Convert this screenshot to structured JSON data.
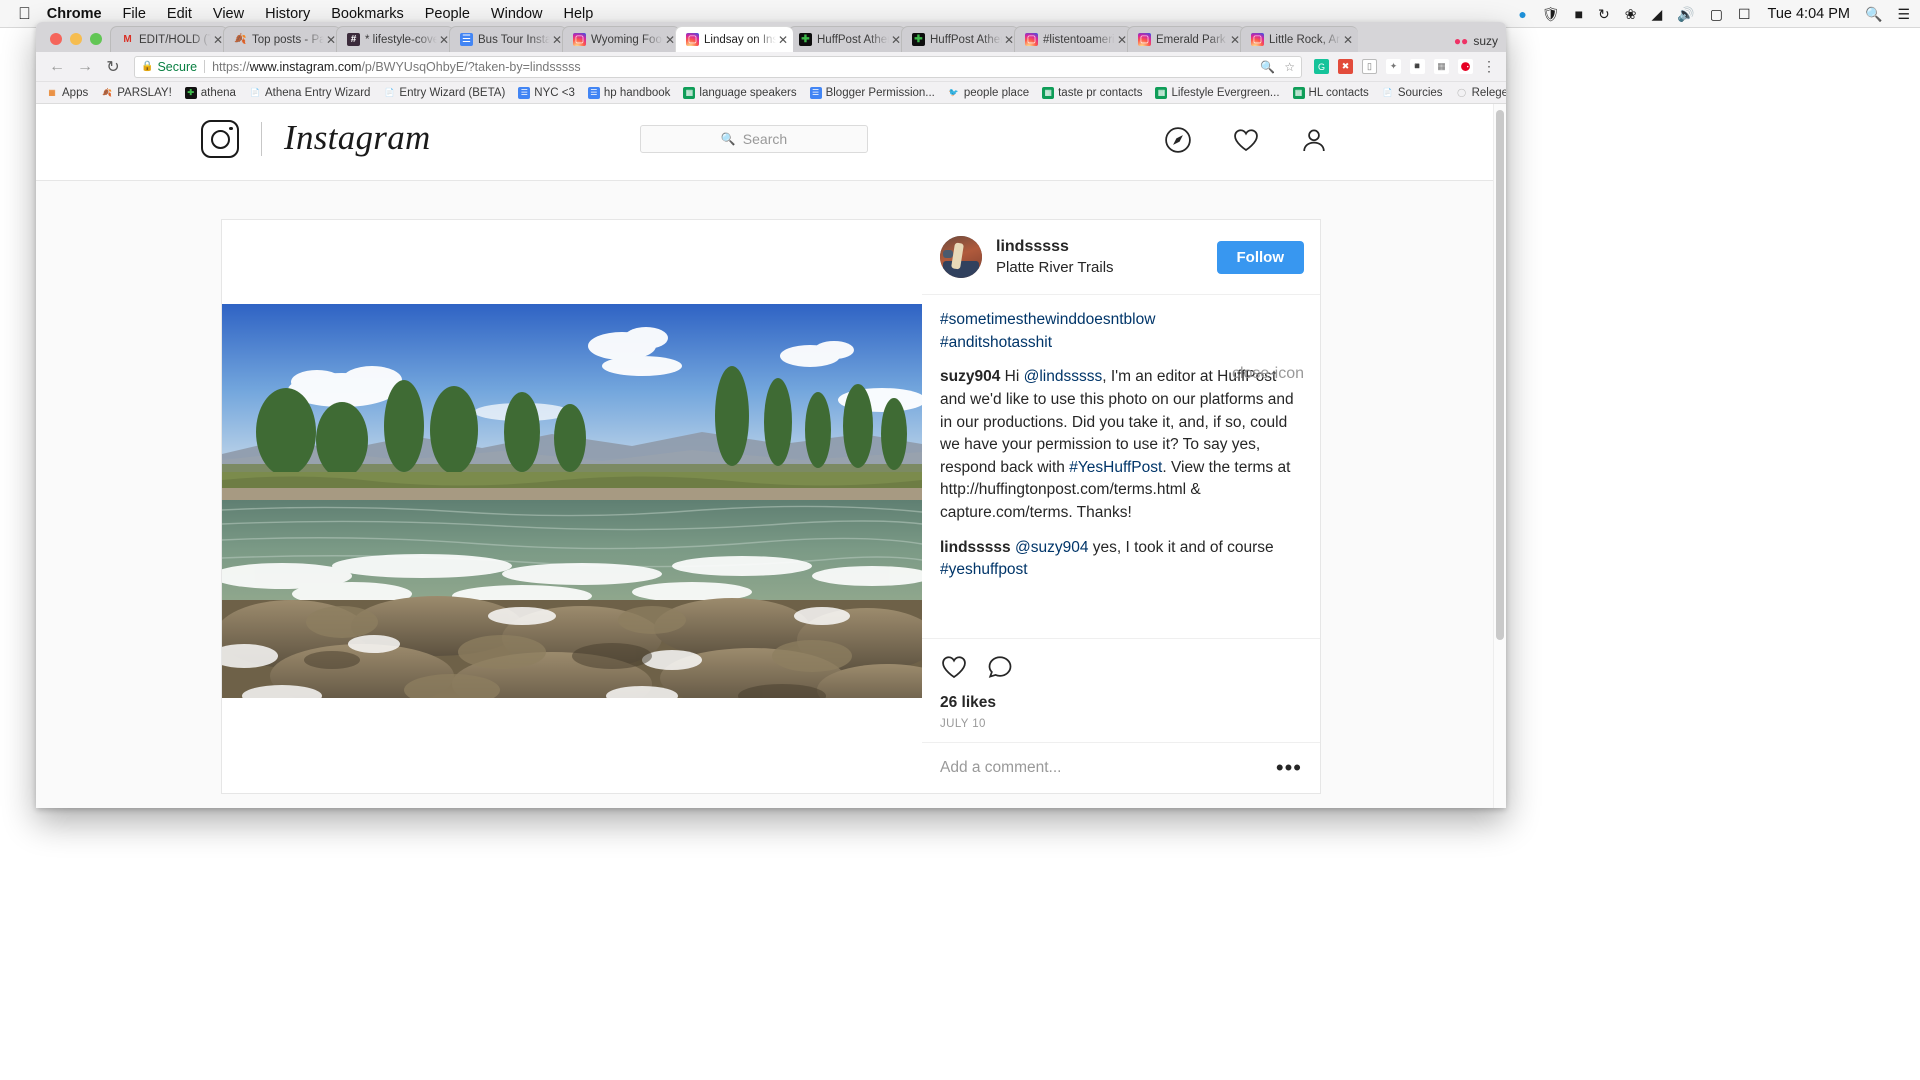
{
  "os_menu": {
    "apple_icon": "apple-logo",
    "items": [
      "Chrome",
      "File",
      "Edit",
      "View",
      "History",
      "Bookmarks",
      "People",
      "Window",
      "Help"
    ],
    "status_icons": [
      "dropbox-icon",
      "shield-icon",
      "battery-icon",
      "time-machine-icon",
      "bluetooth-icon",
      "wifi-icon",
      "volume-icon",
      "screen-icon",
      "input-icon"
    ],
    "clock": "Tue 4:04 PM"
  },
  "browser": {
    "profile_name": "suzy",
    "profile_badge": "person-icon",
    "tabs": [
      {
        "title": "EDIT/HOLD (Tra",
        "favicon": "gmail-icon",
        "active": false
      },
      {
        "title": "Top posts - Pars",
        "favicon": "leaf-icon",
        "active": false
      },
      {
        "title": "* lifestyle-coven",
        "favicon": "slack-icon",
        "active": false
      },
      {
        "title": "Bus Tour Insta P",
        "favicon": "google-doc-icon",
        "active": false
      },
      {
        "title": "Wyoming Food F",
        "favicon": "instagram-icon",
        "active": false
      },
      {
        "title": "Lindsay on Insta",
        "favicon": "instagram-icon",
        "active": true
      },
      {
        "title": "HuffPost Athena",
        "favicon": "huffpost-icon",
        "active": false
      },
      {
        "title": "HuffPost Athena",
        "favicon": "huffpost-icon",
        "active": false
      },
      {
        "title": "#listentoamerica",
        "favicon": "instagram-icon",
        "active": false
      },
      {
        "title": "Emerald Park • I",
        "favicon": "instagram-icon",
        "active": false
      },
      {
        "title": "Little Rock, Arkan",
        "favicon": "instagram-icon",
        "active": false
      }
    ],
    "close_label": "✕",
    "new_tab_label": "+",
    "nav": {
      "back": "←",
      "forward": "→",
      "reload": "↻"
    },
    "omnibox": {
      "lock_icon": "lock-icon",
      "secure_label": "Secure",
      "url_scheme": "https://",
      "url_host": "www.instagram.com",
      "url_path": "/p/BWYUsqOhbyE/?taken-by=lindsssss",
      "star_icon": "star-icon",
      "zoom_icon": "zoom-icon"
    },
    "extensions": [
      "grammarly-icon",
      "block-icon",
      "tab-icon",
      "pin-icon",
      "cast-icon",
      "grid-icon",
      "pinterest-icon"
    ],
    "menu_icon": "chrome-menu-icon",
    "bookmarks": [
      {
        "label": "Apps",
        "icon": "apps-grid-icon"
      },
      {
        "label": "PARSLAY!",
        "icon": "leaf-icon"
      },
      {
        "label": "athena",
        "icon": "huffpost-icon"
      },
      {
        "label": "Athena Entry Wizard",
        "icon": "page-icon"
      },
      {
        "label": "Entry Wizard (BETA)",
        "icon": "page-icon"
      },
      {
        "label": "NYC <3",
        "icon": "google-doc-icon"
      },
      {
        "label": "hp handbook",
        "icon": "google-doc-icon"
      },
      {
        "label": "language speakers",
        "icon": "google-sheet-icon"
      },
      {
        "label": "Blogger Permission...",
        "icon": "google-doc-icon"
      },
      {
        "label": "people place",
        "icon": "bird-icon"
      },
      {
        "label": "taste pr contacts",
        "icon": "google-sheet-icon"
      },
      {
        "label": "Lifestyle Evergreen...",
        "icon": "google-sheet-icon"
      },
      {
        "label": "HL contacts",
        "icon": "google-sheet-icon"
      },
      {
        "label": "Sourcies",
        "icon": "page-icon"
      },
      {
        "label": "Relegence",
        "icon": "circle-icon"
      }
    ],
    "bookmarks_overflow": "»"
  },
  "instagram": {
    "logo_wordmark": "Instagram",
    "camera_icon": "instagram-camera-icon",
    "search": {
      "placeholder": "Search",
      "icon": "search-icon"
    },
    "nav_icons": [
      "compass-explore-icon",
      "heart-activity-icon",
      "person-profile-icon"
    ],
    "post": {
      "username": "lindsssss",
      "location": "Platte River Trails",
      "follow_button": "Follow",
      "avatar": "user-avatar",
      "photo_alt": "river-rapids-photo",
      "caption_hashtags": [
        "#sometimesthewinddoesntblow",
        "#anditshotasshit"
      ],
      "comments": [
        {
          "author": "suzy904",
          "segments": [
            {
              "text": " Hi ",
              "type": "plain"
            },
            {
              "text": "@lindsssss",
              "type": "link"
            },
            {
              "text": ", I'm an editor at HuffPost and we'd like to use this photo on our platforms and in our productions. Did you take it, and, if so, could we have your permission to use it? To say yes, respond back with ",
              "type": "plain"
            },
            {
              "text": "#YesHuffPost",
              "type": "link"
            },
            {
              "text": ". View the terms at http://huffingtonpost.com/terms.html & capture.com/terms. Thanks!",
              "type": "plain"
            }
          ],
          "has_close": true,
          "close_icon": "close-icon"
        },
        {
          "author": "lindsssss",
          "segments": [
            {
              "text": " ",
              "type": "plain"
            },
            {
              "text": "@suzy904",
              "type": "link"
            },
            {
              "text": " yes, I took it and of course ",
              "type": "plain"
            },
            {
              "text": "#yeshuffpost",
              "type": "link"
            }
          ],
          "has_close": false,
          "close_icon": ""
        }
      ],
      "actions": {
        "like_icon": "heart-icon",
        "comment_icon": "speech-bubble-icon"
      },
      "likes": "26 likes",
      "date": "JULY 10",
      "add_comment_placeholder": "Add a comment...",
      "more_options": "•••"
    }
  },
  "colors": {
    "instagram_blue": "#3897f0",
    "link_navy": "#003569",
    "secure_green": "#0a8043",
    "text_primary": "#262626"
  }
}
